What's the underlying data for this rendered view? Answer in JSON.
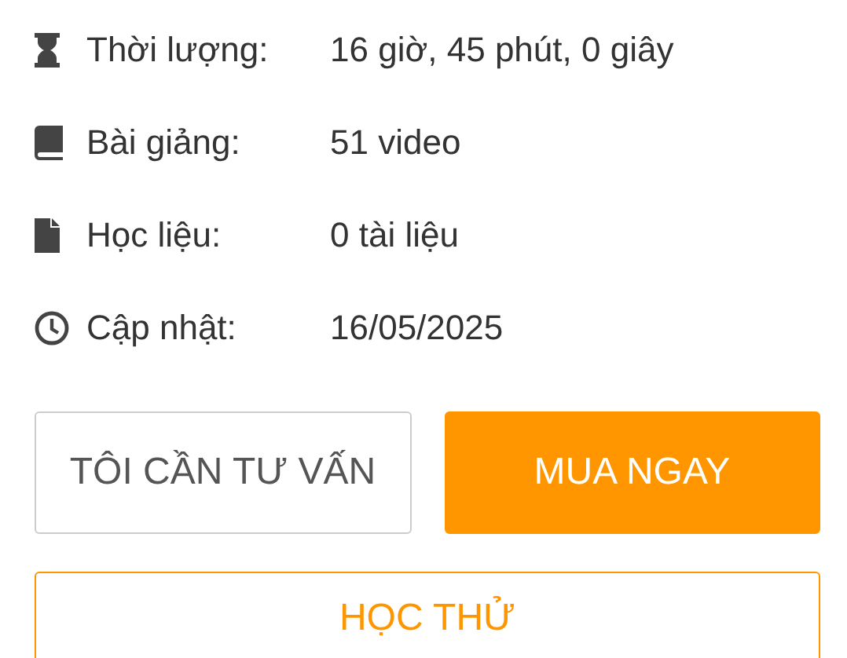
{
  "details": [
    {
      "label": "Thời lượng:",
      "value": "16 giờ, 45 phút, 0 giây"
    },
    {
      "label": "Bài giảng:",
      "value": "51 video"
    },
    {
      "label": "Học liệu:",
      "value": "0 tài liệu"
    },
    {
      "label": "Cập nhật:",
      "value": "16/05/2025"
    }
  ],
  "buttons": [
    {
      "kind": "outline-grey",
      "label": "TÔI CẦN TƯ VẤN"
    },
    {
      "kind": "filled",
      "label": "MUA NGAY"
    },
    {
      "kind": "outline-orange",
      "label": "HỌC THỬ"
    }
  ]
}
